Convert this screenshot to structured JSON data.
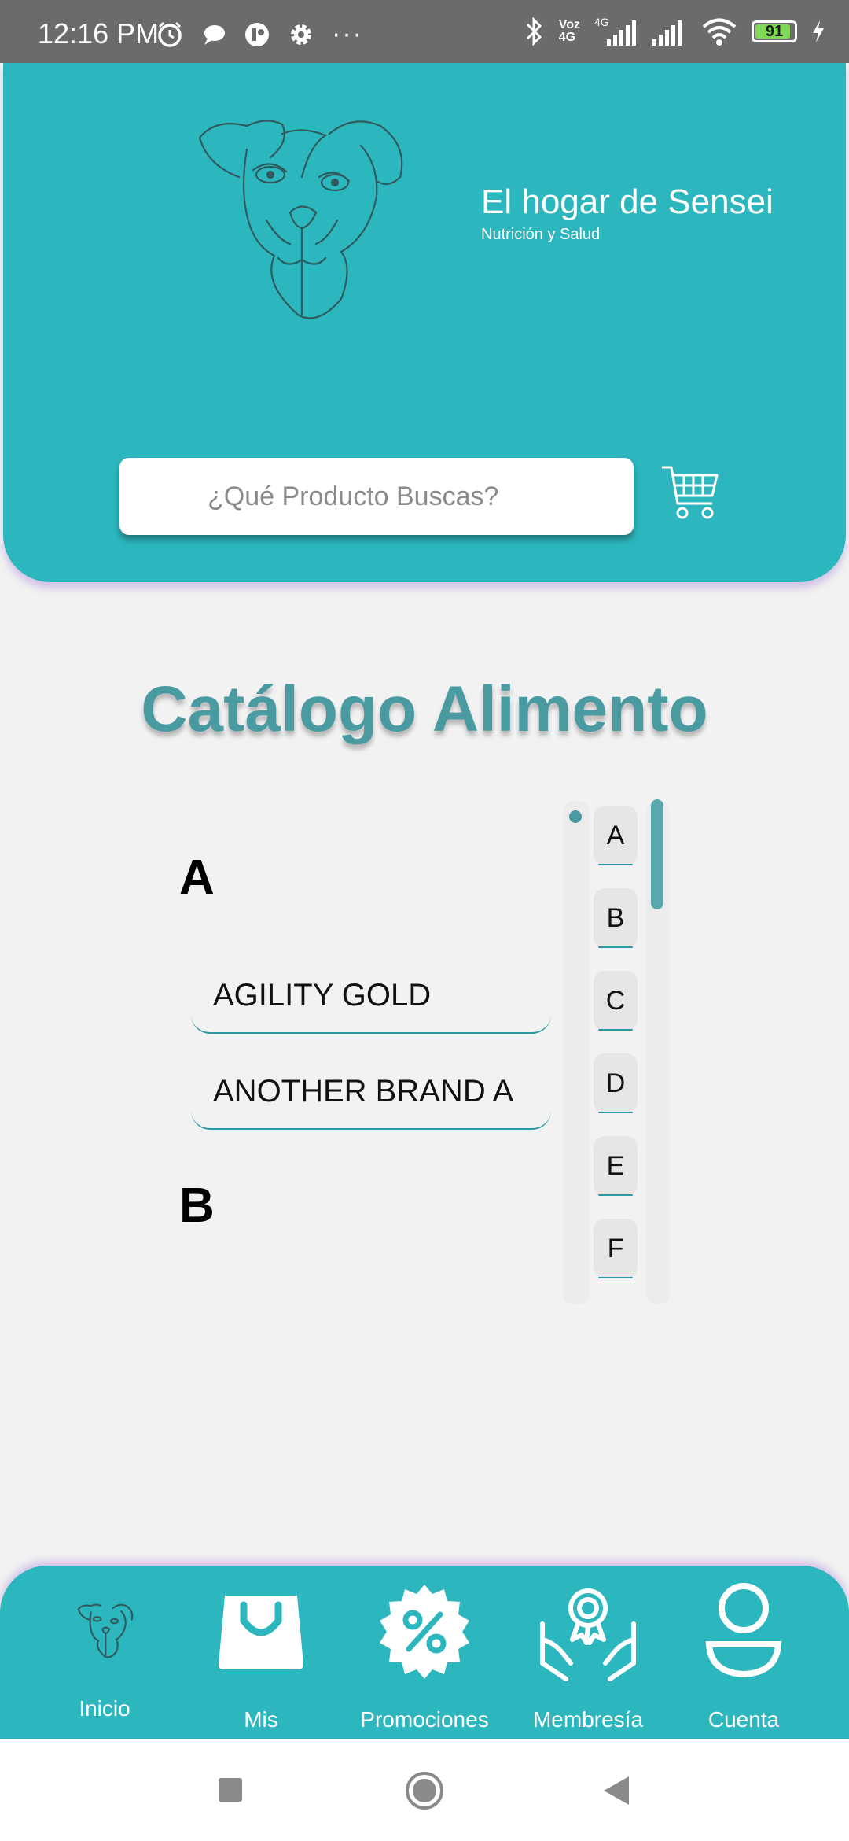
{
  "status_bar": {
    "time": "12:16 PM",
    "network_top": "Voz",
    "network_bottom": "4G",
    "lte_label": "4G",
    "battery": "91",
    "left_icons": [
      "alarm-icon",
      "chat-bubble-icon",
      "app-icon",
      "gear-icon",
      "more-dots-icon"
    ],
    "right_icons": [
      "bluetooth-icon",
      "signal-icon",
      "signal-icon",
      "wifi-icon",
      "battery-icon",
      "charging-icon"
    ]
  },
  "header": {
    "brand_title": "El hogar de Sensei",
    "brand_subtitle": "Nutrición y Salud",
    "search_placeholder": "¿Qué Producto Buscas?",
    "colors": {
      "primary": "#2cb6be",
      "title": "#4a9ba1"
    }
  },
  "catalog": {
    "title": "Catálogo Alimento",
    "sections": [
      {
        "letter": "A",
        "items": [
          "AGILITY GOLD",
          "ANOTHER BRAND A"
        ]
      },
      {
        "letter": "B",
        "items": []
      }
    ],
    "index_letters": [
      "A",
      "B",
      "C",
      "D",
      "E",
      "F"
    ]
  },
  "bottom_nav": {
    "items": [
      {
        "label": "Inicio",
        "icon": "dog-logo-icon"
      },
      {
        "label": "Mis",
        "icon": "shopping-bag-icon"
      },
      {
        "label": "Promociones",
        "icon": "discount-badge-icon"
      },
      {
        "label": "Membresía",
        "icon": "membership-award-icon"
      },
      {
        "label": "Cuenta",
        "icon": "user-icon"
      }
    ]
  }
}
